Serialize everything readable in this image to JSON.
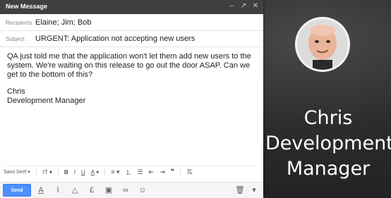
{
  "window": {
    "title": "New Message"
  },
  "recipients": {
    "label": "Recipients",
    "value": "Elaine; Jim; Bob"
  },
  "subject": {
    "label": "Subject",
    "value": "URGENT: Application not accepting new users"
  },
  "message": {
    "paragraph1": "QA just told me that the application won't let them add new users to the system. We're waiting on this release to go out the door ASAP. Can we get to the bottom of this?",
    "signature_name": "Chris",
    "signature_title": "Development Manager"
  },
  "format_toolbar": {
    "font": "Sans Serif",
    "bold": "B",
    "italic": "I",
    "underline": "U",
    "text_color": "A"
  },
  "bottom_bar": {
    "send_label": "Send"
  },
  "person": {
    "name": "Chris",
    "title_line1": "Development",
    "title_line2": "Manager"
  }
}
